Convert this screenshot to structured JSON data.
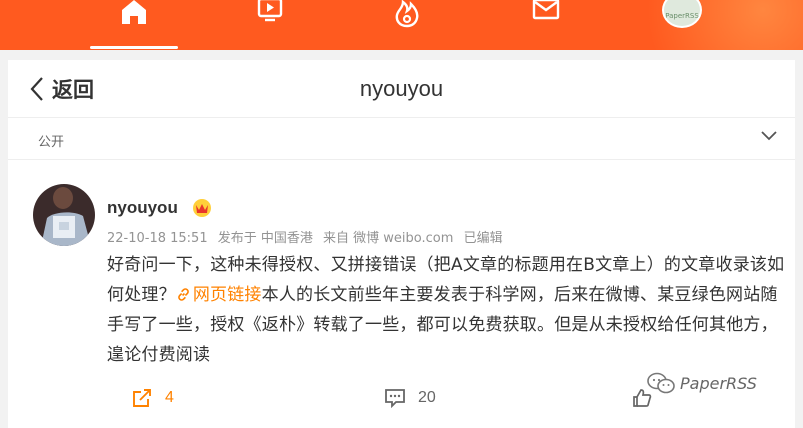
{
  "topnav": {
    "items": [
      {
        "name": "home",
        "icon": "home-icon",
        "active": true
      },
      {
        "name": "video",
        "icon": "video-icon",
        "active": false
      },
      {
        "name": "hot",
        "icon": "flame-icon",
        "active": false
      },
      {
        "name": "messages",
        "icon": "mail-icon",
        "active": false
      },
      {
        "name": "profile",
        "icon": "avatar",
        "active": false
      }
    ],
    "avatar_text": "PaperRSS",
    "color": "#ff5a1f"
  },
  "header": {
    "back_label": "返回",
    "title": "nyouyou"
  },
  "visibility": {
    "label": "公开"
  },
  "post": {
    "author": "nyouyou",
    "meta": {
      "date": "22-10-18 15:51",
      "location": "发布于 中国香港",
      "source": "来自 微博 weibo.com",
      "edited": "已编辑"
    },
    "text_before": "好奇问一下，这种未得授权、又拼接错误（把A文章的标题用在B文章上）的文章收录该如何处理？",
    "link_label": "网页链接",
    "text_after": "本人的长文前些年主要发表于科学网，后来在微博、某豆绿色网站随手写了一些，授权《返朴》转载了一些，都可以免费获取。但是从未授权给任何其他方，遑论付费阅读",
    "repost_count": "4",
    "comment_count": "20",
    "accent_color": "#ff8200"
  },
  "watermark": {
    "text": "PaperRSS"
  }
}
